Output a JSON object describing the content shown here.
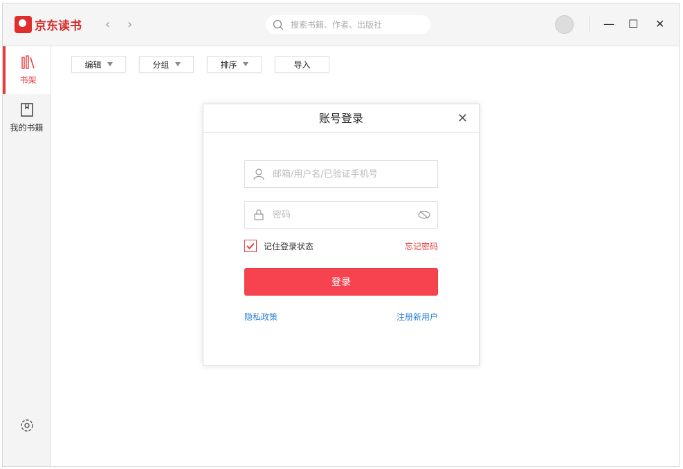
{
  "app": {
    "name": "京东读书"
  },
  "search": {
    "placeholder": "搜索书籍、作者、出版社"
  },
  "sidebar": {
    "items": [
      {
        "label": "书架"
      },
      {
        "label": "我的书籍"
      }
    ]
  },
  "toolbar": {
    "edit": "编辑",
    "group": "分组",
    "sort": "排序",
    "import": "导入"
  },
  "dialog": {
    "title": "账号登录",
    "username_placeholder": "邮箱/用户名/已验证手机号",
    "password_placeholder": "密码",
    "remember": "记住登录状态",
    "remember_checked": true,
    "forgot": "忘记密码",
    "login": "登录",
    "privacy": "隐私政策",
    "register": "注册新用户"
  },
  "colors": {
    "accent": "#e83c3c",
    "button": "#f7434f",
    "link": "#2a7fd0"
  }
}
